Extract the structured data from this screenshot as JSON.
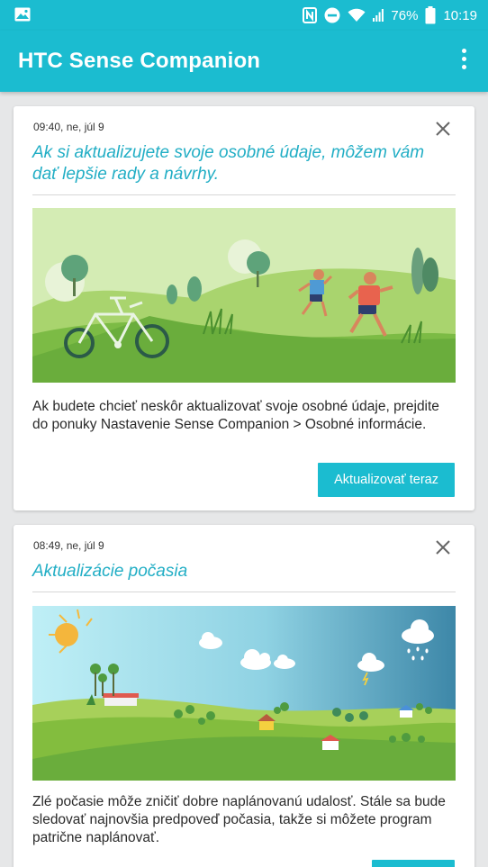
{
  "status": {
    "battery": "76%",
    "time": "10:19"
  },
  "appbar": {
    "title": "HTC Sense Companion"
  },
  "cards": [
    {
      "timestamp": "09:40, ne, júl 9",
      "heading": "Ak si aktualizujete svoje osobné údaje, môžem vám dať lepšie rady a návrhy.",
      "body": "Ak budete chcieť neskôr aktualizovať svoje osobné údaje, prejdite do ponuky Nastavenie Sense Companion > Osobné informácie.",
      "action": "Aktualizovať teraz"
    },
    {
      "timestamp": "08:49, ne, júl 9",
      "heading": "Aktualizácie počasia",
      "body": "Zlé počasie môže zničiť dobre naplánovanú udalosť. Stále sa bude sledovať najnovšia predpoveď počasia, takže si môžete program patrične naplánovať."
    }
  ],
  "colors": {
    "accent": "#1bbcd0",
    "heading": "#22aec5",
    "background": "#e6e7e8"
  }
}
